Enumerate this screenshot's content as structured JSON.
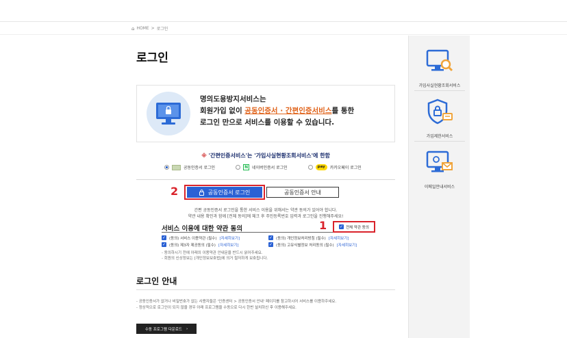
{
  "breadcrumb": {
    "home": "HOME",
    "separator": ">",
    "current": "로그인"
  },
  "page": {
    "title": "로그인"
  },
  "info": {
    "line1": "명의도용방지서비스는",
    "line2_prefix": "회원가입 없이 ",
    "line2_highlight": "공동인증서 · 간편인증서비스",
    "line2_suffix": "를 통한",
    "line3": "로그인 만으로 서비스를 이용할 수 있습니다."
  },
  "notice": {
    "mark": "※",
    "text": " '간편인증서비스'는 '가입사실현황조회서비스'에 한함"
  },
  "methods": [
    {
      "label": "공동인증서 로그인",
      "selected": true
    },
    {
      "label": "네이버인증서 로그인",
      "selected": false
    },
    {
      "badge": "pay",
      "label": "카카오페이 로그인",
      "selected": false
    }
  ],
  "tabs": {
    "step_number": "2",
    "login_label": "공동인증서 로그인",
    "guide_label": "공동인증서 안내"
  },
  "description": {
    "line1": "간편 공동인증서 로그인을 통한 서비스 이용을 위해서는 약관 동의가 있어야 합니다.",
    "line2": "약관 내용 확인과 함께 [전체 동의]에 체크 후 주민등록번호 입력과 로그인을 진행해주세요!"
  },
  "terms": {
    "title": "서비스 이용에 대한 약관 동의",
    "step_number": "1",
    "agree_all": "전체 약관 동의",
    "items": [
      [
        {
          "text": "(동의) 서비스 이용약관 (필수)",
          "link": "[자세히보기]"
        },
        {
          "text": "(동의) 개인정보처리방침 (필수)",
          "link": "[자세히보기]"
        }
      ],
      [
        {
          "text": "(동의) 제3자 제공동의 (필수)",
          "link": "[자세히보기]"
        },
        {
          "text": "(동의) 고유식별정보 처리동의 (필수)",
          "link": "[자세히보기]"
        }
      ]
    ],
    "notes": [
      "- 동의하시기 전에 아래의 이용약관 안내문을 반드시 읽어주세요.",
      "- 회원의 신상정보는 [개인정보보호법]에 의거 철저하게 보호됩니다."
    ]
  },
  "guide": {
    "title": "로그인 안내",
    "lines": [
      "- 공동인증서가 없거나 비밀번호가 없는 사용자들은 '인증센터 > 공동인증서 안내' 페이지를 참고하시어 서비스를 이용하주세요.",
      "- 정상적으로 로그인이 되지 않을 경우 아래 프로그램을 수동으로 다시 한번 설치하신 후 이용해주세요."
    ],
    "download_label": "수동 프로그램 다운로드",
    "download_arrow": "›"
  },
  "sidebar": {
    "items": [
      {
        "label": "가입사실현황조회서비스",
        "icon": "monitor-search-icon"
      },
      {
        "label": "가입제한서비스",
        "icon": "shield-lock-icon"
      },
      {
        "label": "이메일안내서비스",
        "icon": "monitor-mail-icon"
      }
    ]
  },
  "colors": {
    "accent": "#2a61d4",
    "highlight": "#e0641c",
    "marker": "#d9222a",
    "navy": "#1c2f6e"
  }
}
